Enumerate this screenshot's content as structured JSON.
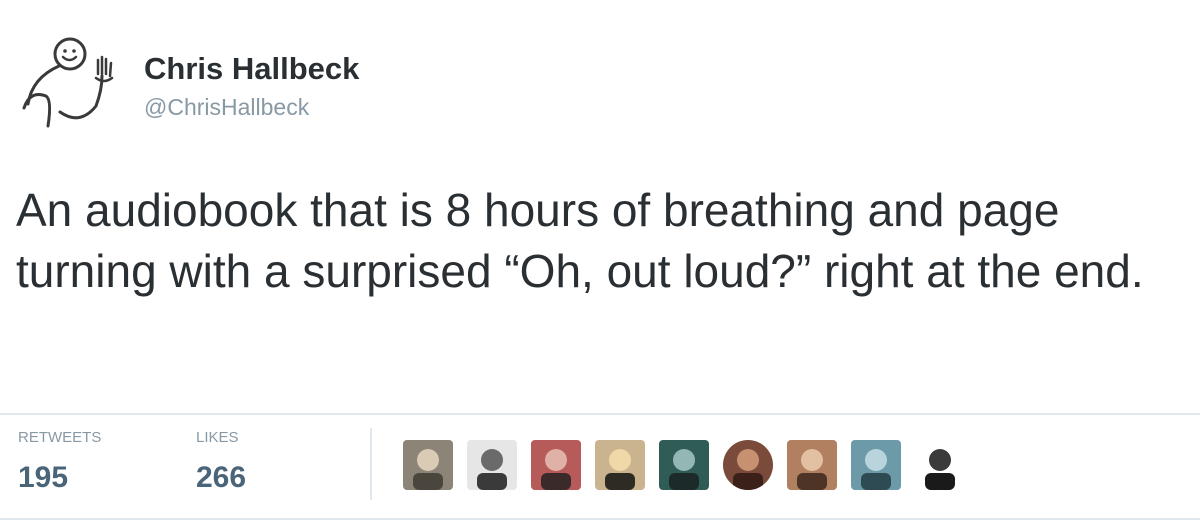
{
  "author": {
    "display_name": "Chris Hallbeck",
    "handle": "@ChrisHallbeck",
    "avatar_icon": "stick-figure-waving-icon"
  },
  "tweet": {
    "text": "An audiobook that is 8 hours of breathing and page turning with a surprised “Oh, out loud?” right at the end."
  },
  "stats": {
    "retweets_label": "RETWEETS",
    "retweets_count": "195",
    "likes_label": "LIKES",
    "likes_count": "266"
  },
  "likers": [
    {
      "name": "liker-avatar-1",
      "colors": [
        "#8c8577",
        "#d9cbb4",
        "#4a463e"
      ]
    },
    {
      "name": "liker-avatar-2",
      "colors": [
        "#e6e6e6",
        "#6a6a6a",
        "#3a3a3a"
      ]
    },
    {
      "name": "liker-avatar-3",
      "colors": [
        "#b65a5a",
        "#e0b1a6",
        "#3b2a2a"
      ]
    },
    {
      "name": "liker-avatar-4",
      "colors": [
        "#c9b48f",
        "#f1d8a8",
        "#2e2a24"
      ]
    },
    {
      "name": "liker-avatar-5",
      "colors": [
        "#2f5d55",
        "#93b7b2",
        "#1c2b2a"
      ]
    },
    {
      "name": "liker-avatar-6",
      "colors": [
        "#7a4a3a",
        "#c79171",
        "#3a2018"
      ]
    },
    {
      "name": "liker-avatar-7",
      "colors": [
        "#b08061",
        "#e4c0a2",
        "#4e3426"
      ]
    },
    {
      "name": "liker-avatar-8",
      "colors": [
        "#6d9aa8",
        "#b9d4dc",
        "#2e4a52"
      ]
    },
    {
      "name": "liker-avatar-9",
      "colors": [
        "#ffffff",
        "#3b3b3b",
        "#1a1a1a"
      ]
    }
  ]
}
